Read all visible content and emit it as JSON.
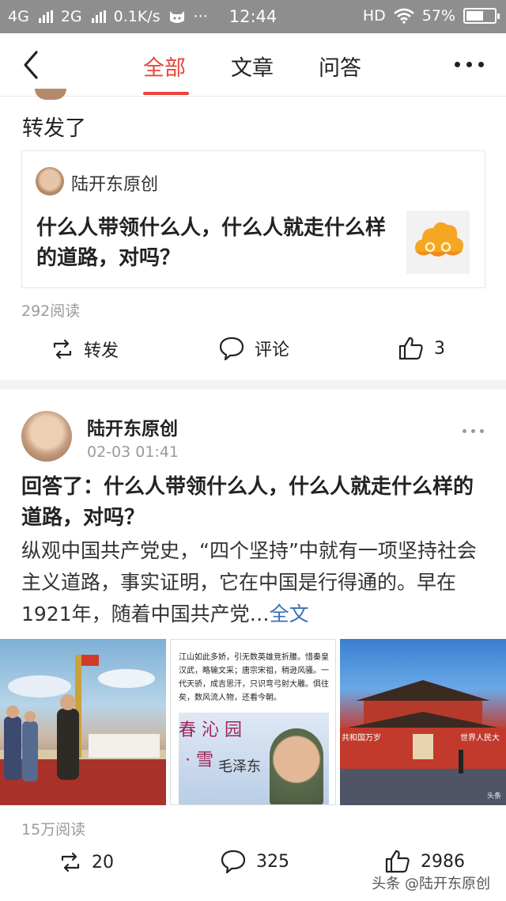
{
  "status_bar": {
    "net1": "4G",
    "net2": "2G",
    "speed": "0.1K/s",
    "dots": "···",
    "time": "12:44",
    "hd": "HD",
    "battery": "57%"
  },
  "nav": {
    "tabs": [
      "全部",
      "文章",
      "问答"
    ],
    "active_tab": 0
  },
  "repost": {
    "text": "转发了",
    "card": {
      "author": "陆开东原创",
      "title": "什么人带领什么人，什么人就走什么样的道路，对吗？"
    },
    "read_count": "292阅读",
    "actions": {
      "forward_label": "转发",
      "comment_label": "评论",
      "like_count": "3"
    }
  },
  "answer_post": {
    "author": "陆开东原创",
    "time": "02-03 01:41",
    "title": "回答了：什么人带领什么人，什么人就走什么样的道路，对吗？",
    "body": "纵观中国共产党史，“四个坚持”中就有一项坚持社会主义道路，事实证明，它在中国是行得通的。早在1921年，随着中国共产党…",
    "more_link": "全文",
    "image2": {
      "poem": "江山如此多娇，引无数英雄竞折腰。惜秦皇汉武，略输文采；唐宗宋祖，稍逊风骚。一代天骄，成吉思汗，只识弯弓射大雕。俱往矣，数风流人物，还看今朝。",
      "callig_a": "春 沁 园",
      "callig_b": "· 雪",
      "callig_c": "毛泽东"
    },
    "image3": {
      "banner_left": "共和国万岁",
      "banner_right": "世界人民大",
      "watermark": "头条"
    },
    "read_count": "15万阅读",
    "actions": {
      "forward_count": "20",
      "comment_count": "325",
      "like_count": "2986"
    }
  },
  "footer_watermark": "头条 @陆开东原创",
  "colors": {
    "accent": "#e8453c",
    "link": "#3b6fb6",
    "status_bar": "#8e8e8e"
  }
}
